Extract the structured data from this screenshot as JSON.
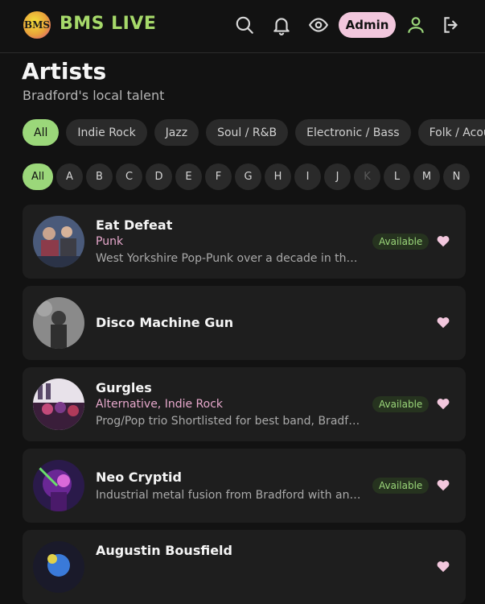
{
  "header": {
    "logo_text": "BMS",
    "brand": "BMS LIVE",
    "admin_label": "Admin"
  },
  "page": {
    "title": "Artists",
    "subtitle": "Bradford's local talent"
  },
  "genres": [
    "All",
    "Indie Rock",
    "Jazz",
    "Soul / R&B",
    "Electronic / Bass",
    "Folk / Acous"
  ],
  "letters": [
    "All",
    "A",
    "B",
    "C",
    "D",
    "E",
    "F",
    "G",
    "H",
    "I",
    "J",
    "K",
    "L",
    "M",
    "N"
  ],
  "artists": [
    {
      "name": "Eat Defeat",
      "genre": "Punk",
      "description": "West Yorkshire Pop-Punk over a decade in the ...",
      "status": "Available"
    },
    {
      "name": "Disco Machine Gun",
      "genre": "",
      "description": "",
      "status": ""
    },
    {
      "name": "Gurgles",
      "genre": "Alternative, Indie Rock",
      "description": "Prog/Pop trio Shortlisted for best band, Bradford...",
      "status": "Available"
    },
    {
      "name": "Neo Cryptid",
      "genre": "",
      "description": "Industrial metal fusion from Bradford with an ele...",
      "status": "Available"
    },
    {
      "name": "Augustin Bousfield",
      "genre": "",
      "description": "",
      "status": ""
    }
  ],
  "colors": {
    "accent_green": "#9bd77a",
    "accent_pink": "#f2c7dd",
    "background": "#121212",
    "card": "#1e1e1e"
  }
}
